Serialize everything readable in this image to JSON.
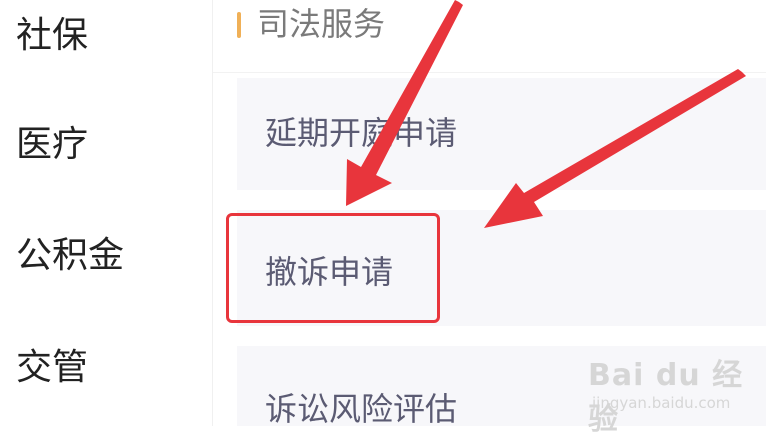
{
  "left_nav": {
    "items": [
      {
        "label": "社保"
      },
      {
        "label": "医疗"
      },
      {
        "label": "公积金"
      },
      {
        "label": "交管"
      }
    ]
  },
  "section": {
    "title": "司法服务"
  },
  "services": [
    {
      "label": "延期开庭申请"
    },
    {
      "label": "撤诉申请"
    },
    {
      "label": "诉讼风险评估"
    }
  ],
  "annotation": {
    "highlight_color": "#e8353c",
    "arrow_color": "#e8353c"
  },
  "watermark": {
    "logo": "Bai du 经验",
    "url": "jingyan.baidu.com"
  }
}
